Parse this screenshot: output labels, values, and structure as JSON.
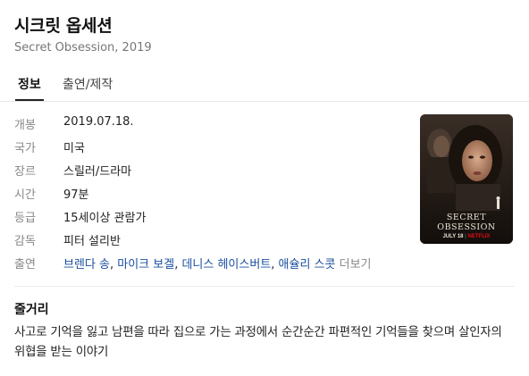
{
  "title": "시크릿 옵세션",
  "subtitle": "Secret Obsession, 2019",
  "tabs": [
    {
      "label": "정보",
      "active": true
    },
    {
      "label": "출연/제작",
      "active": false
    }
  ],
  "info": {
    "release_label": "개봉",
    "release_value": "2019.07.18.",
    "country_label": "국가",
    "country_value": "미국",
    "genre_label": "장르",
    "genre_value": "스릴러/드라마",
    "runtime_label": "시간",
    "runtime_value": "97분",
    "rating_label": "등급",
    "rating_value": "15세이상 관람가",
    "director_label": "감독",
    "director_value": "피터 설리반",
    "cast_label": "출연",
    "cast": [
      "브렌다 송",
      "마이크 보겔",
      "데니스 헤이스버트",
      "애슐리 스콧"
    ],
    "more_label": "더보기"
  },
  "poster": {
    "title_line1": "SECRET",
    "title_line2": "OBSESSION",
    "date": "JULY 18",
    "brand": "NETFLIX",
    "brand_color": "#e50914"
  },
  "summary": {
    "heading": "줄거리",
    "text": "사고로 기억을 잃고 남편을 따라 집으로 가는 과정에서 순간순간 파편적인 기억들을 찾으며 살인자의 위협을 받는 이야기"
  }
}
